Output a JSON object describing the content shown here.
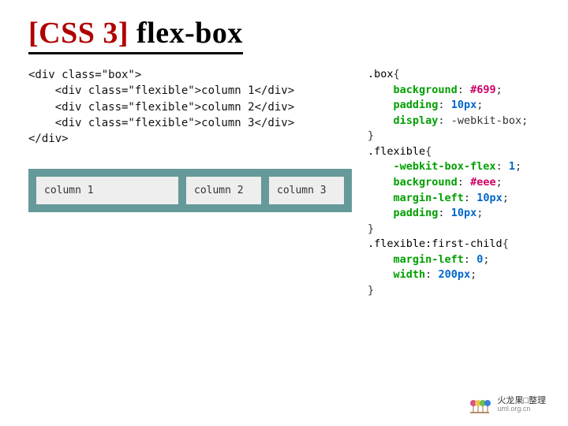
{
  "title": {
    "prefix": "[CSS 3]",
    "topic": " flex-box"
  },
  "html_code": "<div class=\"box\">\n    <div class=\"flexible\">column 1</div>\n    <div class=\"flexible\">column 2</div>\n    <div class=\"flexible\">column 3</div>\n</div>",
  "demo": {
    "columns": [
      "column 1",
      "column 2",
      "column 3"
    ]
  },
  "css_rules": [
    {
      "selector": ".box",
      "decls": [
        {
          "prop": "background",
          "value": "#699",
          "kind": "hex"
        },
        {
          "prop": "padding",
          "value": "10px",
          "kind": "num"
        },
        {
          "prop": "display",
          "value": "-webkit-box",
          "kind": "ident"
        }
      ]
    },
    {
      "selector": ".flexible",
      "decls": [
        {
          "prop": "-webkit-box-flex",
          "value": "1",
          "kind": "num"
        },
        {
          "prop": "background",
          "value": "#eee",
          "kind": "hex"
        },
        {
          "prop": "margin-left",
          "value": "10px",
          "kind": "num"
        },
        {
          "prop": "padding",
          "value": "10px",
          "kind": "num"
        }
      ]
    },
    {
      "selector": ".flexible:first-child",
      "decls": [
        {
          "prop": "margin-left",
          "value": "0",
          "kind": "num"
        },
        {
          "prop": "width",
          "value": "200px",
          "kind": "num"
        }
      ]
    }
  ],
  "footer": {
    "line1": "火龙果□整理",
    "line2": "uml.org.cn"
  }
}
